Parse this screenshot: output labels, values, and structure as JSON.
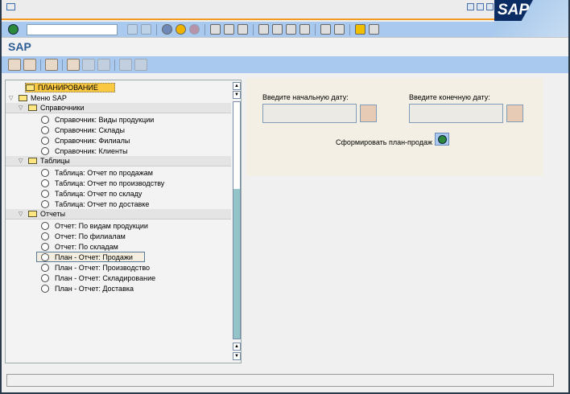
{
  "title": "SAP",
  "logo": "SAP",
  "command_field": {
    "value": ""
  },
  "tree": {
    "root": "ПЛАНИРОВАНИЕ",
    "menu": "Меню SAP",
    "groups": [
      {
        "label": "Справочники",
        "items": [
          "Справочник: Виды продукции",
          "Справочник: Склады",
          "Справочник: Филиалы",
          "Справочник: Клиенты"
        ]
      },
      {
        "label": "Таблицы",
        "items": [
          "Таблица: Отчет по продажам",
          "Таблица: Отчет по производству",
          "Таблица: Отчет по складу",
          "Таблица: Отчет по доставке"
        ]
      },
      {
        "label": "Отчеты",
        "items": [
          "Отчет: По видам продукции",
          "Отчет: По филиалам",
          "Отчет: По складам",
          "План - Отчет: Продажи",
          "План - Отчет: Производство",
          "План - Отчет: Складирование",
          "План - Отчет: Доставка"
        ]
      }
    ],
    "selected": "План - Отчет: Продажи"
  },
  "form": {
    "start_label": "Введите начальную дату:",
    "end_label": "Введите конечную дату:",
    "start_value": "",
    "end_value": "",
    "generate_label": "Сформировать план-продаж"
  }
}
